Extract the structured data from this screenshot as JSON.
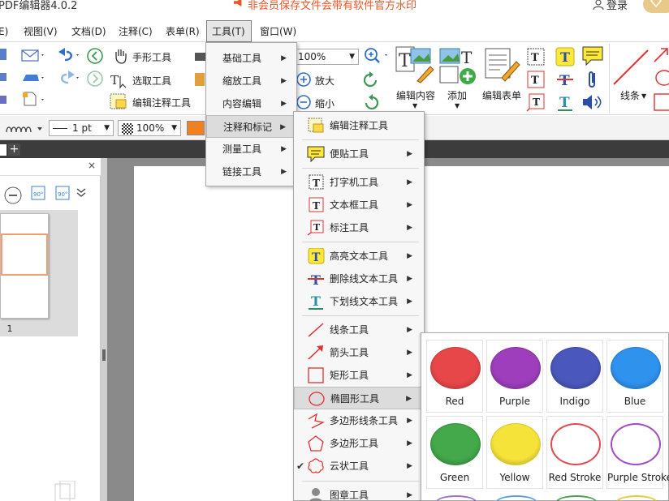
{
  "app": {
    "title": "PDF编辑器4.0.2",
    "notice": "非会员保存文件会带有软件官方水印",
    "login": "登录"
  },
  "menubar": [
    "E)",
    "视图(V)",
    "文档(D)",
    "注释(C)",
    "表单(R)",
    "工具(T)",
    "窗口(W)"
  ],
  "ribbon": {
    "hand_tool": "手形工具",
    "select_tool": "选取工具",
    "edit_annot_tool": "编辑注释工具",
    "zoom_value": "100%",
    "zoom_in": "放大",
    "zoom_out": "缩小",
    "edit_content": "编辑内容",
    "add": "添加",
    "edit_form": "编辑表单",
    "lines": "线条"
  },
  "propbar": {
    "line_width": "1 pt",
    "opacity": "100%"
  },
  "thumbnail": {
    "page_number": "1"
  },
  "tools_menu": [
    {
      "label": "基础工具"
    },
    {
      "label": "缩放工具"
    },
    {
      "label": "内容编辑"
    },
    {
      "label": "注释和标记"
    },
    {
      "label": "测量工具"
    },
    {
      "label": "链接工具"
    }
  ],
  "annot_submenu": [
    {
      "label": "编辑注释工具",
      "icon": "edit-annotation-icon",
      "arrow": false
    },
    {
      "label": "便贴工具",
      "icon": "sticky-note-icon",
      "arrow": true
    },
    {
      "label": "打字机工具",
      "icon": "typewriter-icon",
      "arrow": true
    },
    {
      "label": "文本框工具",
      "icon": "textbox-icon",
      "arrow": true
    },
    {
      "label": "标注工具",
      "icon": "callout-icon",
      "arrow": true
    },
    {
      "label": "高亮文本工具",
      "icon": "highlight-icon",
      "arrow": true
    },
    {
      "label": "删除线文本工具",
      "icon": "strikethrough-icon",
      "arrow": true
    },
    {
      "label": "下划线文本工具",
      "icon": "underline-icon",
      "arrow": true
    },
    {
      "label": "线条工具",
      "icon": "line-icon",
      "arrow": true
    },
    {
      "label": "箭头工具",
      "icon": "arrow-icon",
      "arrow": true
    },
    {
      "label": "矩形工具",
      "icon": "rectangle-icon",
      "arrow": true
    },
    {
      "label": "椭圆形工具",
      "icon": "ellipse-icon",
      "arrow": true
    },
    {
      "label": "多边形线条工具",
      "icon": "polyline-icon",
      "arrow": true
    },
    {
      "label": "多边形工具",
      "icon": "polygon-icon",
      "arrow": true
    },
    {
      "label": "云状工具",
      "icon": "cloud-icon",
      "arrow": true
    },
    {
      "label": "图章工具",
      "icon": "stamp-icon",
      "arrow": true
    }
  ],
  "swatches": [
    {
      "label": "Red",
      "fill": "#e8474a",
      "stroke": "#c93a3c",
      "style": "fill"
    },
    {
      "label": "Purple",
      "fill": "#9e3ebd",
      "stroke": "#86329f",
      "style": "fill"
    },
    {
      "label": "Indigo",
      "fill": "#4a58bd",
      "stroke": "#3d489e",
      "style": "fill"
    },
    {
      "label": "Blue",
      "fill": "#2f93ee",
      "stroke": "#2579c6",
      "style": "fill"
    },
    {
      "label": "Green",
      "fill": "#43a94a",
      "stroke": "#378c3d",
      "style": "fill"
    },
    {
      "label": "Yellow",
      "fill": "#f6e33a",
      "stroke": "#d9c62c",
      "style": "fill"
    },
    {
      "label": "Red Stroke",
      "fill": "#ffffff",
      "stroke": "#e24a4d",
      "style": "stroke"
    },
    {
      "label": "Purple Stroke",
      "fill": "#ffffff",
      "stroke": "#a24cc3",
      "style": "stroke"
    }
  ],
  "colors": {
    "notice": "#e8562a",
    "tabbar": "#3c3c3c",
    "page_bg": "#8a8a8a"
  }
}
